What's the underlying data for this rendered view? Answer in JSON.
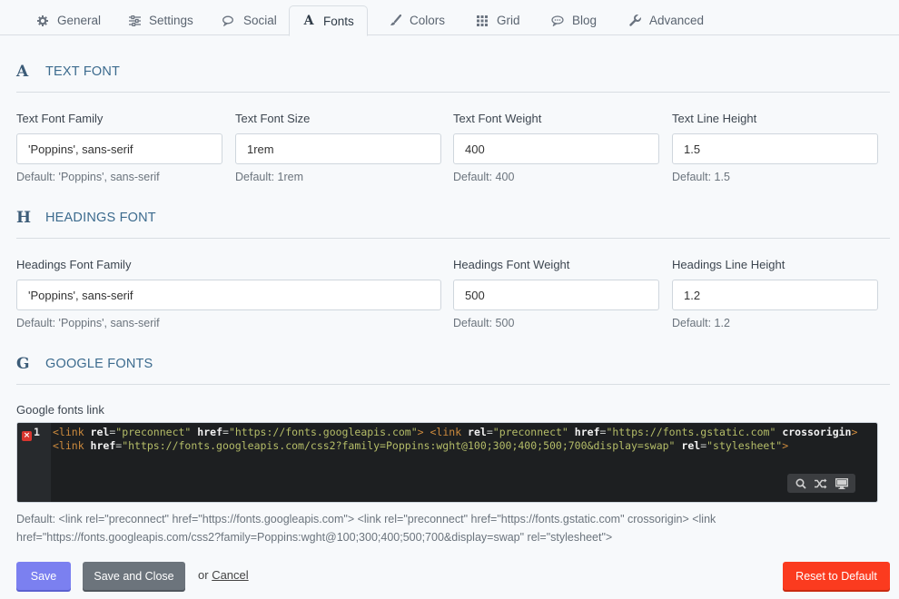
{
  "tabs": [
    {
      "label": "General",
      "icon": "gear-icon"
    },
    {
      "label": "Settings",
      "icon": "sliders-icon"
    },
    {
      "label": "Social",
      "icon": "comments-icon"
    },
    {
      "label": "Fonts",
      "icon": "font-icon",
      "active": true
    },
    {
      "label": "Colors",
      "icon": "brush-icon"
    },
    {
      "label": "Grid",
      "icon": "grid-icon"
    },
    {
      "label": "Blog",
      "icon": "chat-bubble-icon"
    },
    {
      "label": "Advanced",
      "icon": "wrench-icon"
    }
  ],
  "sections": {
    "text_font": {
      "letter": "A",
      "title": "TEXT FONT",
      "fields": [
        {
          "label": "Text Font Family",
          "value": "'Poppins', sans-serif",
          "default": "Default: 'Poppins', sans-serif"
        },
        {
          "label": "Text Font Size",
          "value": "1rem",
          "default": "Default: 1rem"
        },
        {
          "label": "Text Font Weight",
          "value": "400",
          "default": "Default: 400"
        },
        {
          "label": "Text Line Height",
          "value": "1.5",
          "default": "Default: 1.5"
        }
      ]
    },
    "headings_font": {
      "letter": "H",
      "title": "HEADINGS FONT",
      "fields": [
        {
          "label": "Headings Font Family",
          "value": "'Poppins', sans-serif",
          "default": "Default: 'Poppins', sans-serif"
        },
        {
          "label": "Headings Font Weight",
          "value": "500",
          "default": "Default: 500"
        },
        {
          "label": "Headings Line Height",
          "value": "1.2",
          "default": "Default: 1.2"
        }
      ]
    },
    "google_fonts": {
      "letter": "G",
      "title": "GOOGLE FONTS",
      "field_label": "Google fonts link",
      "line_number": "1",
      "error_marker": "×",
      "code": {
        "t1": "<link ",
        "a1": "rel",
        "e1": "=",
        "s1": "\"preconnect\"",
        "a2": "href",
        "e2": "=",
        "s2": "\"https://fonts.googleapis.com\"",
        "t2": "> <link ",
        "a3": "rel",
        "e3": "=",
        "s3": "\"preconnect\"",
        "a4": "href",
        "e4": "=",
        "s4": "\"https://fonts.gstatic.com\"",
        "a5": "crossorigin",
        "t3": "> <link ",
        "a6": "href",
        "e6": "=",
        "s6": "\"https://fonts.googleapis.com/css2?family=Poppins:wght@100;300;400;500;700&display=swap\"",
        "a7": "rel",
        "e7": "=",
        "s7": "\"stylesheet\"",
        "t4": ">"
      },
      "default": "Default: <link rel=\"preconnect\" href=\"https://fonts.googleapis.com\"> <link rel=\"preconnect\" href=\"https://fonts.gstatic.com\" crossorigin> <link href=\"https://fonts.googleapis.com/css2?family=Poppins:wght@100;300;400;500;700&display=swap\" rel=\"stylesheet\">"
    }
  },
  "editor_tools": [
    "search-icon",
    "shuffle-icon",
    "monitor-icon"
  ],
  "actions": {
    "save": "Save",
    "save_close": "Save and Close",
    "or": "or",
    "cancel": "Cancel",
    "reset": "Reset to Default"
  },
  "colors": {
    "save": "#7b80f0",
    "save_close": "#6c747c",
    "reset": "#fb3b1f",
    "section_title": "#3c6b8e"
  }
}
